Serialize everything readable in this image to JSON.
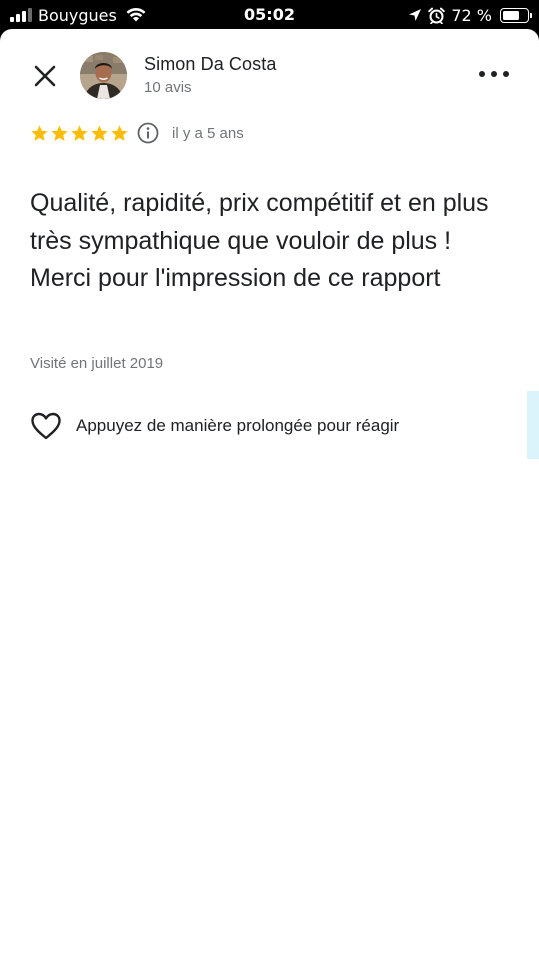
{
  "status_bar": {
    "carrier": "Bouygues",
    "time": "05:02",
    "battery_percent": "72 %",
    "battery_level": 0.72,
    "signal_bars_active": 3,
    "icons": [
      "signal-icon",
      "wifi-icon",
      "location-arrow-icon",
      "alarm-icon",
      "battery-icon"
    ]
  },
  "review": {
    "reviewer_name": "Simon Da Costa",
    "reviewer_count": "10 avis",
    "rating": 5,
    "date": "il y a 5 ans",
    "text": "Qualité, rapidité, prix compétitif et en plus très sympathique que vouloir de plus !\nMerci pour l'impression de ce rapport",
    "visited": "Visité en juillet 2019"
  },
  "reaction": {
    "label": "Appuyez de manière prolongée pour réagir"
  },
  "colors": {
    "star": "#fbbc04",
    "secondary_text": "#70757a",
    "primary_text": "#202124",
    "edge_tab": "#dbf3fb"
  }
}
